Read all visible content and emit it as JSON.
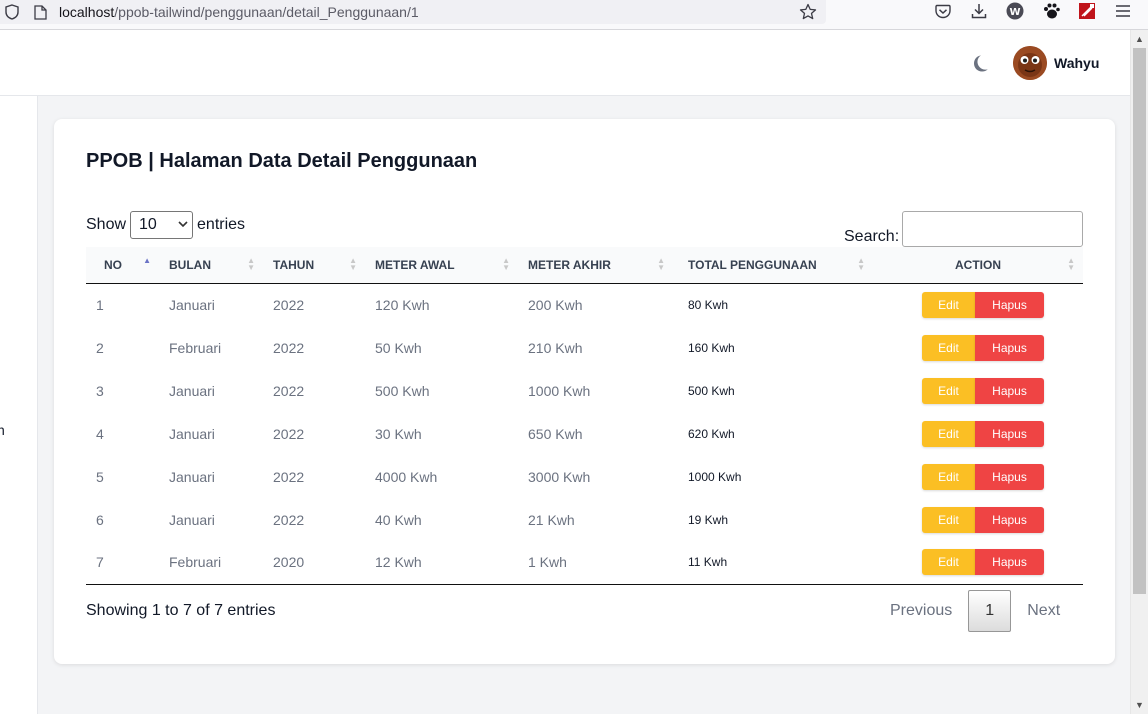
{
  "browser": {
    "url_host": "localhost",
    "url_path": "/ppob-tailwind/penggunaan/detail_Penggunaan/1"
  },
  "header": {
    "user_name": "Wahyu"
  },
  "sidebar": {
    "fragment": "n"
  },
  "page": {
    "title": "PPOB | Halaman Data Detail Penggunaan"
  },
  "table_controls": {
    "show_label": "Show",
    "length_value": "10",
    "entries_label": "entries",
    "search_label": "Search:",
    "search_value": ""
  },
  "table": {
    "columns": [
      "NO",
      "BULAN",
      "TAHUN",
      "METER AWAL",
      "METER AKHIR",
      "TOTAL PENGGUNAAN",
      "ACTION"
    ],
    "rows": [
      {
        "no": "1",
        "bulan": "Januari",
        "tahun": "2022",
        "meter_awal": "120 Kwh",
        "meter_akhir": "200 Kwh",
        "total": "80 Kwh"
      },
      {
        "no": "2",
        "bulan": "Februari",
        "tahun": "2022",
        "meter_awal": "50 Kwh",
        "meter_akhir": "210 Kwh",
        "total": "160 Kwh"
      },
      {
        "no": "3",
        "bulan": "Januari",
        "tahun": "2022",
        "meter_awal": "500 Kwh",
        "meter_akhir": "1000 Kwh",
        "total": "500 Kwh"
      },
      {
        "no": "4",
        "bulan": "Januari",
        "tahun": "2022",
        "meter_awal": "30 Kwh",
        "meter_akhir": "650 Kwh",
        "total": "620 Kwh"
      },
      {
        "no": "5",
        "bulan": "Januari",
        "tahun": "2022",
        "meter_awal": "4000 Kwh",
        "meter_akhir": "3000 Kwh",
        "total": "1000 Kwh"
      },
      {
        "no": "6",
        "bulan": "Januari",
        "tahun": "2022",
        "meter_awal": "40 Kwh",
        "meter_akhir": "21 Kwh",
        "total": "19 Kwh"
      },
      {
        "no": "7",
        "bulan": "Februari",
        "tahun": "2020",
        "meter_awal": "12 Kwh",
        "meter_akhir": "1 Kwh",
        "total": "11 Kwh"
      }
    ],
    "edit_label": "Edit",
    "delete_label": "Hapus"
  },
  "footer": {
    "info": "Showing 1 to 7 of 7 entries",
    "prev_label": "Previous",
    "current_page": "1",
    "next_label": "Next"
  },
  "colors": {
    "edit_button": "#fbbf24",
    "delete_button": "#ef4444",
    "sort_active": "#6b73c6"
  },
  "icons": [
    "shield-icon",
    "page-info-icon",
    "bookmark-star-icon",
    "pocket-icon",
    "download-icon",
    "extension-w-icon",
    "extension-paw-icon",
    "extension-flash-icon",
    "menu-icon",
    "moon-icon",
    "avatar"
  ]
}
